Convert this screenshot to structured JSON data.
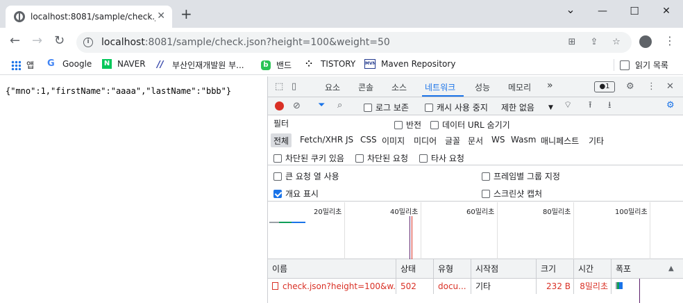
{
  "browser": {
    "tab_title": "localhost:8081/sample/check.json",
    "tab_close": "✕",
    "new_tab": "+",
    "window": {
      "minimize": "—",
      "maximize": "☐",
      "close": "✕",
      "tabsearch": "⌄"
    },
    "url_host": "localhost",
    "url_rest": ":8081/sample/check.json?height=100&weight=50"
  },
  "bookmarks": [
    {
      "label": "앱",
      "icon": "apps-grid-icon"
    },
    {
      "label": "Google",
      "icon": "google-icon"
    },
    {
      "label": "NAVER",
      "icon": "naver-icon"
    },
    {
      "label": "부산인재개발원 부...",
      "icon": "slash-logo-icon"
    },
    {
      "label": "밴드",
      "icon": "band-icon"
    },
    {
      "label": "TISTORY",
      "icon": "tistory-icon"
    },
    {
      "label": "Maven Repository",
      "icon": "mvn-icon"
    },
    {
      "label": "읽기 목록",
      "icon": "reading-list-icon"
    }
  ],
  "page": {
    "json_text": "{\"mno\":1,\"firstName\":\"aaaa\",\"lastName\":\"bbb\"}"
  },
  "devtools": {
    "tabs": [
      "요소",
      "콘솔",
      "소스",
      "네트워크",
      "성능",
      "메모리"
    ],
    "more_tabs": "»",
    "issues_count": "●1",
    "toolbar": {
      "preserve_log": "로그 보존",
      "disable_cache": "캐시 사용 중지",
      "throttle": "제한 없음"
    },
    "filter": {
      "placeholder": "필터",
      "invert": "반전",
      "hide_data_urls": "데이터 URL 숨기기"
    },
    "type_filters": [
      "전체",
      "Fetch/XHR",
      "JS",
      "CSS",
      "이미지",
      "미디어",
      "글꼴",
      "문서",
      "WS",
      "Wasm",
      "매니페스트",
      "기타"
    ],
    "blocked": {
      "blocked_cookies": "차단된 쿠키 있음",
      "blocked_requests": "차단된 요청",
      "third_party": "타사 요청"
    },
    "settings": {
      "big_rows": "큰 요청 열 사용",
      "group_by_frame": "프레임별 그룹 지정",
      "show_overview": "개요 표시",
      "capture_screenshots": "스크린샷 캡처"
    },
    "timeline_labels": [
      "20밀리초",
      "40밀리초",
      "60밀리초",
      "80밀리초",
      "100밀리초"
    ],
    "columns": [
      "이름",
      "상태",
      "유형",
      "시작점",
      "크기",
      "시간",
      "폭포"
    ],
    "sort_indicator": "▲",
    "rows": [
      {
        "name": "check.json?height=100&w...",
        "status": "502",
        "type": "docu...",
        "initiator": "기타",
        "size": "232 B",
        "time": "8밀리초"
      }
    ]
  },
  "colors": {
    "accent": "#1a73e8",
    "error": "#d93025",
    "record": "#d93025"
  }
}
